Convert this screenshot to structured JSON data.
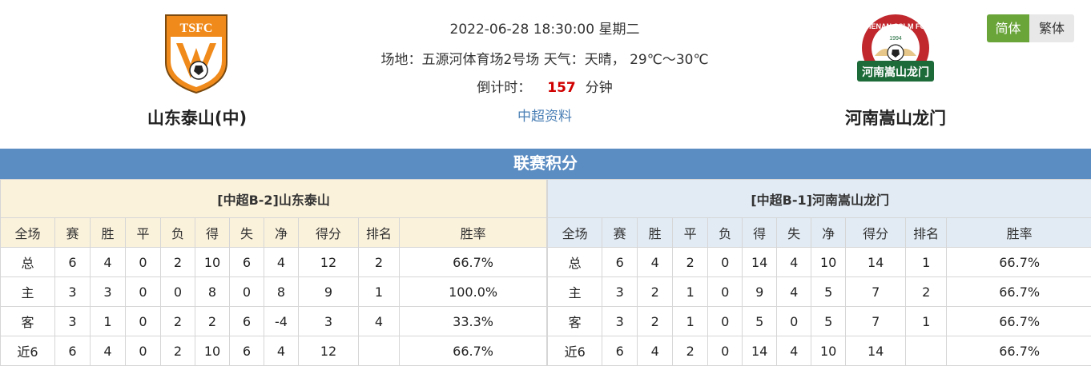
{
  "match": {
    "datetime": "2022-06-28 18:30:00 星期二",
    "venue_label": "场地：",
    "venue": "五源河体育场2号场",
    "weather_label": "天气：",
    "weather": "天晴， 29℃～30℃",
    "countdown_label": "倒计时：",
    "countdown_value": "157",
    "countdown_unit": "分钟",
    "league_link": "中超资料"
  },
  "home_team": {
    "name": "山东泰山(中)",
    "logo_text": "TSFC"
  },
  "away_team": {
    "name": "河南嵩山龙门",
    "logo_top": "HENAN SSLM FC",
    "logo_year": "1994",
    "logo_banner": "河南嵩山龙门"
  },
  "lang": {
    "simplified": "简体",
    "traditional": "繁体"
  },
  "section_title": "联赛积分",
  "columns": [
    "全场",
    "赛",
    "胜",
    "平",
    "负",
    "得",
    "失",
    "净",
    "得分",
    "排名",
    "胜率"
  ],
  "home_table": {
    "caption": "[中超B-2]山东泰山",
    "rows": [
      [
        "总",
        "6",
        "4",
        "0",
        "2",
        "10",
        "6",
        "4",
        "12",
        "2",
        "66.7%"
      ],
      [
        "主",
        "3",
        "3",
        "0",
        "0",
        "8",
        "0",
        "8",
        "9",
        "1",
        "100.0%"
      ],
      [
        "客",
        "3",
        "1",
        "0",
        "2",
        "2",
        "6",
        "-4",
        "3",
        "4",
        "33.3%"
      ],
      [
        "近6",
        "6",
        "4",
        "0",
        "2",
        "10",
        "6",
        "4",
        "12",
        "",
        "66.7%"
      ]
    ]
  },
  "away_table": {
    "caption": "[中超B-1]河南嵩山龙门",
    "rows": [
      [
        "总",
        "6",
        "4",
        "2",
        "0",
        "14",
        "4",
        "10",
        "14",
        "1",
        "66.7%"
      ],
      [
        "主",
        "3",
        "2",
        "1",
        "0",
        "9",
        "4",
        "5",
        "7",
        "2",
        "66.7%"
      ],
      [
        "客",
        "3",
        "2",
        "1",
        "0",
        "5",
        "0",
        "5",
        "7",
        "1",
        "66.7%"
      ],
      [
        "近6",
        "6",
        "4",
        "2",
        "0",
        "14",
        "4",
        "10",
        "14",
        "",
        "66.7%"
      ]
    ]
  },
  "colors": {
    "section_bar": "#5b8cc2",
    "active_lang": "#6aa53a",
    "countdown": "#d00000",
    "home_label": "#d00000",
    "away_label": "#1a2fa8"
  }
}
